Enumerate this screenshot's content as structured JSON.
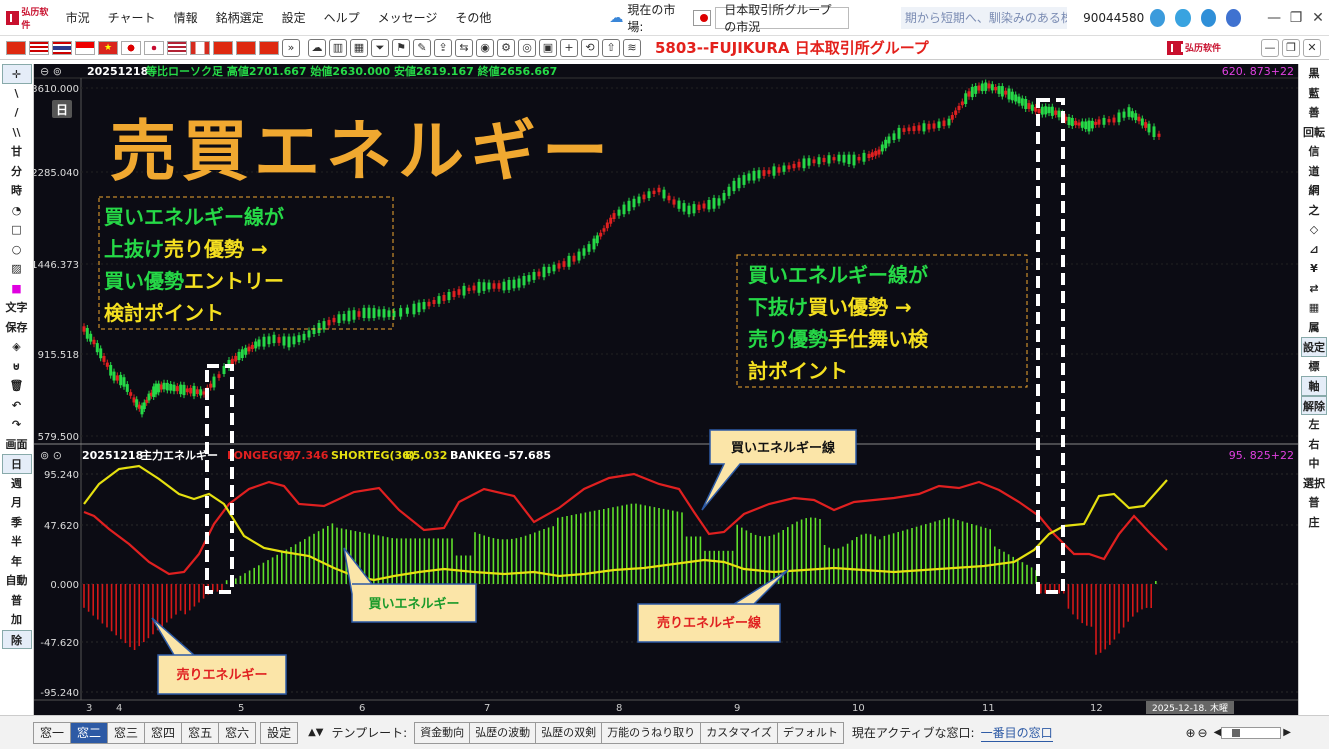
{
  "menubar": {
    "logo": "弘历软件",
    "items": [
      "市況",
      "チャート",
      "情報",
      "銘柄選定",
      "設定",
      "ヘルプ",
      "メッセージ",
      "その他"
    ],
    "market_label": "現在の市場:",
    "market_value": "日本取引所グループの市況",
    "ticker": "期から短期へ、馴染みのある株だけ",
    "user_id": "90044580"
  },
  "toolbar": {
    "stock_title": "5803--FUJIKURA  日本取引所グループ",
    "logo": "弘历软件"
  },
  "main_chart": {
    "date": "20251218",
    "info": "等比ローソク足 高値2701.667 始値2630.000 安値2619.167 終値2656.667",
    "right_value": "620. 873+22",
    "y_ticks": [
      "3610.000",
      "2285.040",
      "1446.373",
      "915.518",
      "579.500"
    ],
    "period_badge": "日",
    "title_overlay": "売買エネルギー",
    "annotation_left": [
      "買いエネルギー線が",
      "上抜け売り優勢 →",
      "買い優勢エントリー",
      "検討ポイント"
    ],
    "annotation_right": [
      "買いエネルギー線が",
      "下抜け買い優勢 →",
      "売り優勢手仕舞い検",
      "討ポイント"
    ]
  },
  "sub_chart": {
    "date": "20251218",
    "name": "主力エネルギー",
    "longeg_label": "LONGEG(9)",
    "longeg_value": "27.346",
    "shorteg_label": "SHORTEG(36)",
    "shorteg_value": "85.032",
    "bankeg_label": "BANKEG",
    "bankeg_value": "-57.685",
    "right_value": "95. 825+22",
    "y_ticks": [
      "95.240",
      "47.620",
      "0.000",
      "-47.620",
      "-95.240"
    ],
    "callout_buy_line": "買いエネルギー線",
    "callout_buy": "買いエネルギー",
    "callout_sell_line": "売りエネルギー線",
    "callout_sell": "売りエネルギー"
  },
  "x_axis": {
    "labels": [
      "3",
      "4",
      "5",
      "6",
      "7",
      "8",
      "9",
      "10",
      "11",
      "12"
    ],
    "date_badge": "2025-12-18. 木曜"
  },
  "left_tools": [
    "✛",
    "\\",
    "/",
    "\\\\",
    "甘",
    "分",
    "時",
    "◔",
    "□",
    "○",
    "▨",
    "■",
    "文字",
    "保存",
    "◈",
    "⊍",
    "🗑",
    "↶",
    "↷",
    "画面",
    "日",
    "週",
    "月",
    "季",
    "半",
    "年",
    "自動",
    "普",
    "加",
    "除"
  ],
  "right_tools": [
    "黒",
    "藍",
    "善",
    "回転",
    "信",
    "道",
    "網",
    "之",
    "◇",
    "⊿",
    "¥",
    "⇄",
    "▦",
    "属",
    "設定",
    "標",
    "軸",
    "解除",
    "左",
    "右",
    "中",
    "選択",
    "普",
    "庄"
  ],
  "bottom": {
    "windows": [
      "窓一",
      "窓二",
      "窓三",
      "窓四",
      "窓五",
      "窓六"
    ],
    "active_window": "窓二",
    "settings": "設定",
    "template_label": "テンプレート:",
    "templates": [
      "資金動向",
      "弘歴の波動",
      "弘歴の双剣",
      "万能のうねり取り",
      "カスタマイズ",
      "デフォルト"
    ],
    "active_label": "現在アクティブな窓口:",
    "active_value": "一番目の窓口"
  },
  "colors": {
    "chart_bg": "#0c0c14",
    "up": "#26d947",
    "down": "#e02020",
    "buy_line": "#e5e010",
    "sell_line": "#e02020",
    "annotation": "#f0a830",
    "accent": "#2d5aa5"
  }
}
